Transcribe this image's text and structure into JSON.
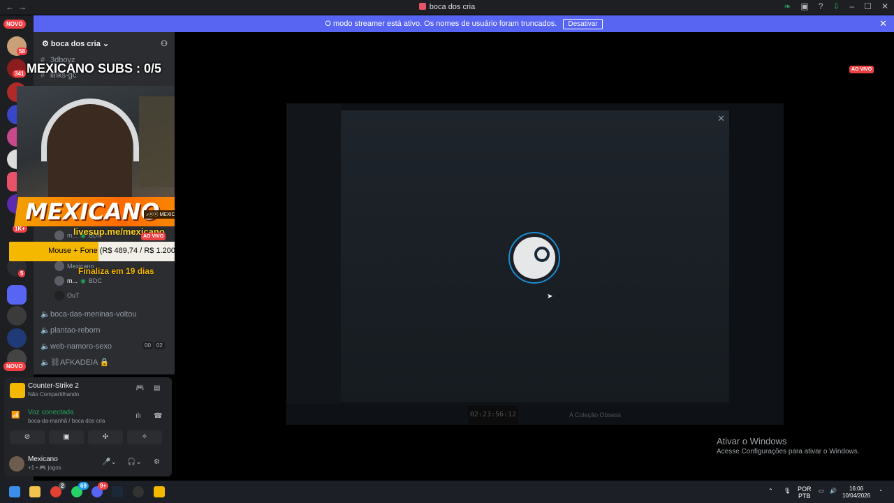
{
  "window": {
    "title": "boca dos cria"
  },
  "banner": {
    "message": "O modo streamer está ativo. Os nomes de usuário foram truncados.",
    "button_label": "Desativar",
    "close": "✕"
  },
  "servers": {
    "novo_top": "NOVO",
    "novo_bottom": "NOVO",
    "badges": [
      "58",
      "341",
      "1K+",
      "5"
    ]
  },
  "guild": {
    "name": "boca dos cria",
    "channels_text": [
      "3dboyz",
      "links-gc"
    ],
    "voice_users": [
      {
        "name": "m...",
        "tag": "BDC"
      },
      {
        "name": "Mexicano"
      },
      {
        "name": "m...",
        "tag": "BDC"
      },
      {
        "name": "OuT"
      }
    ],
    "voice_channels": [
      "boca-das-meninas-voltou",
      "plantao-reborn",
      "web-namoro-sexo",
      "⛓AFKADEIA 🔒"
    ],
    "web_counts": [
      "00",
      "02"
    ]
  },
  "stream_overlay": {
    "subs_title": "MEXICANO SUBS : 0/5",
    "streamer_name": "MEXICANO",
    "social_tag": "♪ⓞⓧ MEXICANORP",
    "livesup_url": "livesup.me/mexicano",
    "goal_text": "Mouse + Fone (R$ 489,74 / R$ 1.200,00)",
    "goal_progress": 0.408,
    "finaliza": "Finaliza em 19 dias",
    "live_label": "AO VIVO",
    "live_label_top": "AO VIVO"
  },
  "activity": {
    "game": "Counter-Strike 2",
    "game_status": "Não Compartilhando",
    "voice_status": "Voz conectada",
    "voice_location": "boca-da-manhã / boca dos cria"
  },
  "user": {
    "name": "Mexicano",
    "status": "+1 • 🎮 jogos"
  },
  "game_bg": {
    "timer": "02:23:56:12",
    "collection": "A Coleção Obsess"
  },
  "windows_activation": {
    "line1": "Ativar o Windows",
    "line2": "Acesse Configurações para ativar o Windows."
  },
  "taskbar": {
    "lang": "POR",
    "layout": "PTB",
    "time": "16:06",
    "date": "10/04/2026",
    "badges": [
      "2",
      "69",
      "9+"
    ]
  }
}
